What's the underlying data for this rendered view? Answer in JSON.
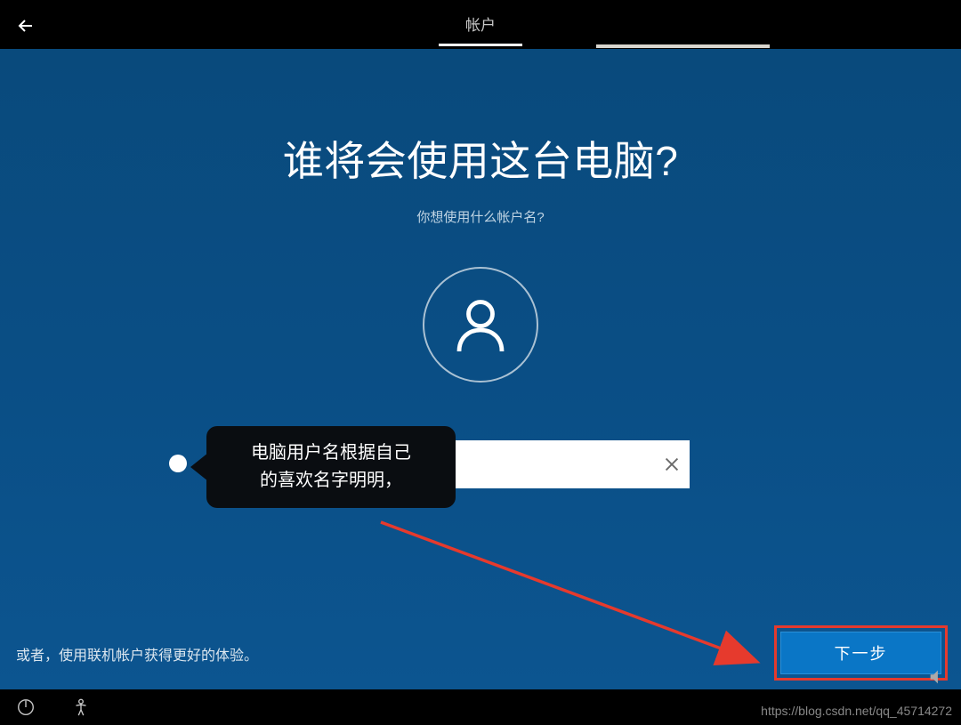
{
  "topbar": {
    "tab_label": "帐户"
  },
  "main": {
    "heading": "谁将会使用这台电脑?",
    "subheading": "你想使用什么帐户名?",
    "input_value": "",
    "bottom_link": "或者，使用联机帐户获得更好的体验。",
    "next_button": "下一步"
  },
  "tooltip": {
    "line1": "电脑用户名根据自己",
    "line2": "的喜欢名字明明，"
  },
  "watermark": "https://blog.csdn.net/qq_45714272",
  "colors": {
    "bg_main": "#0a4e85",
    "annotation_red": "#e63a2d",
    "button_blue": "#0a76c6"
  }
}
